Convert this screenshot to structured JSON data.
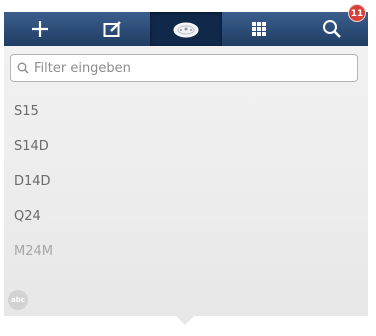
{
  "toolbar": {
    "buttons": [
      {
        "icon": "plus-icon"
      },
      {
        "icon": "edit-icon"
      },
      {
        "icon": "location-icon",
        "active": true
      },
      {
        "icon": "grid-icon"
      },
      {
        "icon": "search-icon",
        "badge": "11"
      }
    ]
  },
  "filter": {
    "placeholder": "Filter eingeben",
    "value": ""
  },
  "list": {
    "items": [
      {
        "label": "S15"
      },
      {
        "label": "S14D"
      },
      {
        "label": "D14D"
      },
      {
        "label": "Q24"
      },
      {
        "label": "M24M"
      }
    ]
  },
  "footer": {
    "abc_label": "abc"
  },
  "colors": {
    "toolbar_top": "#3a5e8c",
    "toolbar_bottom": "#203d63",
    "active_button": "#10284a",
    "badge": "#d8403a",
    "list_text": "#6a6a6a"
  }
}
